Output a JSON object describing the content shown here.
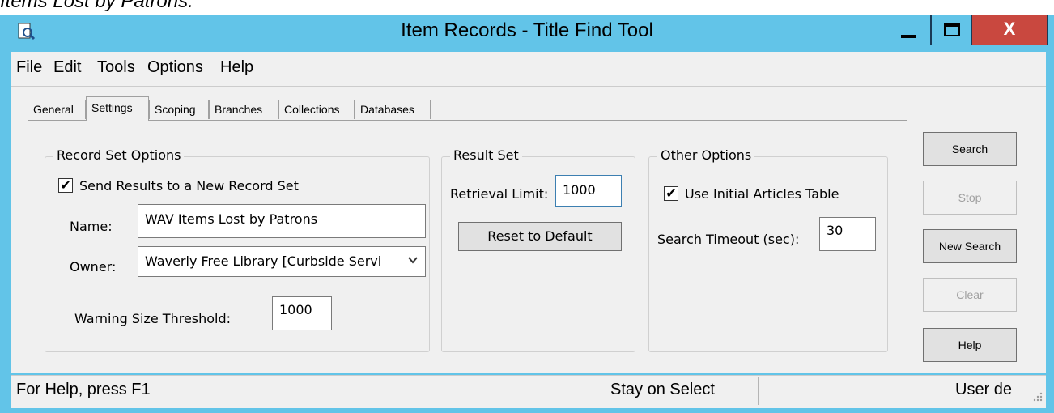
{
  "doc_caption": "Items Lost by Patrons.",
  "window": {
    "title": "Item Records - Title Find Tool",
    "minimize_glyph": "_",
    "maximize_glyph": "□",
    "close_glyph": "X"
  },
  "menu": [
    "File",
    "Edit",
    "Tools",
    "Options",
    "Help"
  ],
  "tabs": [
    "General",
    "Settings",
    "Scoping",
    "Branches",
    "Collections",
    "Databases"
  ],
  "active_tab": "Settings",
  "record_set_options": {
    "title": "Record Set Options",
    "send_results_label": "Send Results to a New Record Set",
    "send_results_checked": true,
    "name_label": "Name:",
    "name_value": "WAV Items Lost by Patrons",
    "owner_label": "Owner:",
    "owner_value": "Waverly Free Library [Curbside Servi",
    "warning_label": "Warning Size Threshold:",
    "warning_value": "1000"
  },
  "result_set": {
    "title": "Result Set",
    "retrieval_label": "Retrieval Limit:",
    "retrieval_value": "1000",
    "reset_label": "Reset to Default"
  },
  "other_options": {
    "title": "Other Options",
    "initial_articles_label": "Use Initial Articles Table",
    "initial_articles_checked": true,
    "timeout_label": "Search Timeout (sec):",
    "timeout_value": "30"
  },
  "side_buttons": {
    "search": "Search",
    "stop": "Stop",
    "new_search": "New Search",
    "clear": "Clear",
    "help": "Help"
  },
  "status": {
    "help_text": "For Help, press F1",
    "mode": "Stay on Select",
    "user": "User de"
  },
  "colors": {
    "titlebar": "#62c4e8",
    "close_button": "#c9483f",
    "dialog_bg": "#f0f0f0"
  }
}
